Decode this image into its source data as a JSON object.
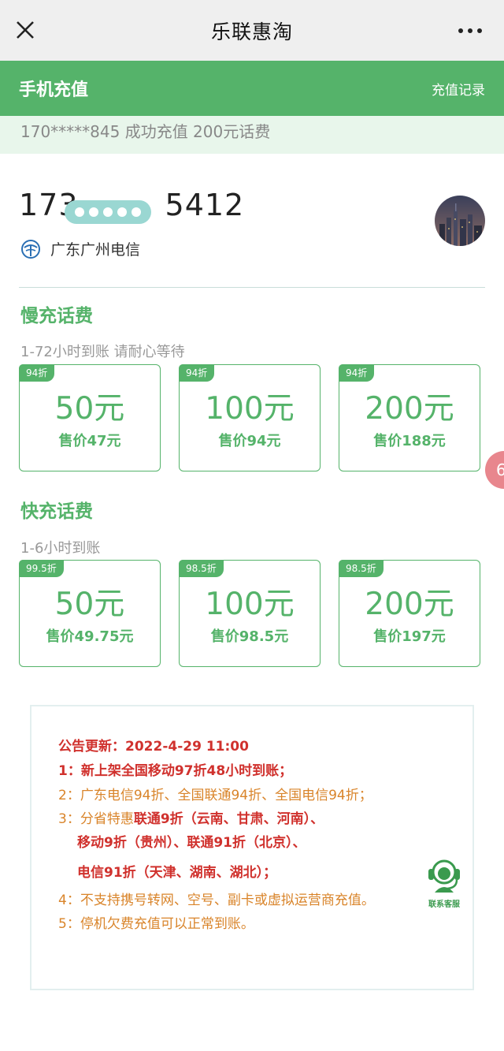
{
  "app": {
    "title": "乐联惠淘"
  },
  "header": {
    "title": "手机充值",
    "record_link": "充值记录"
  },
  "ticker": {
    "text": "170*****845 成功充值 200元话费"
  },
  "account": {
    "phone_prefix": "173",
    "phone_suffix": "5412",
    "carrier": "广东广州电信"
  },
  "slow": {
    "title": "慢充话费",
    "subtitle": "1-72小时到账 请耐心等待",
    "items": [
      {
        "badge": "94折",
        "amount": "50元",
        "price": "售价47元"
      },
      {
        "badge": "94折",
        "amount": "100元",
        "price": "售价94元"
      },
      {
        "badge": "94折",
        "amount": "200元",
        "price": "售价188元"
      }
    ]
  },
  "fast": {
    "title": "快充话费",
    "subtitle": "1-6小时到账",
    "items": [
      {
        "badge": "99.5折",
        "amount": "50元",
        "price": "售价49.75元"
      },
      {
        "badge": "98.5折",
        "amount": "100元",
        "price": "售价98.5元"
      },
      {
        "badge": "98.5折",
        "amount": "200元",
        "price": "售价197元"
      }
    ]
  },
  "float_button": {
    "label": "6"
  },
  "notice": {
    "line1": "公告更新：2022-4-29 11:00",
    "line2": "1：新上架全国移动97折48小时到账；",
    "line3": "2：广东电信94折、全国联通94折、全国电信94折；",
    "line4a": "3：分省特惠",
    "line4b": "联通9折（云南、甘肃、河南）、",
    "line5": "移动9折（贵州）、联通91折（北京）、",
    "line6": "电信91折（天津、湖南、湖北）；",
    "line7": "4：不支持携号转网、空号、副卡或虚拟运营商充值。",
    "line8": "5：停机欠费充值可以正常到账。",
    "service_label": "联系客服"
  },
  "colors": {
    "brand_green": "#55b36a",
    "notice_red": "#d0312d",
    "notice_orange": "#d9842a"
  }
}
